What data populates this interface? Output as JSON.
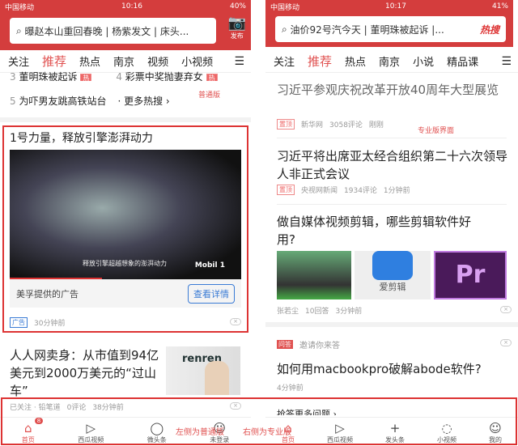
{
  "left": {
    "status": {
      "carrier": "中国移动",
      "time": "10:16",
      "battery": "40%"
    },
    "search": "曝赵本山重回春晚 | 杨紫发文 | 床头...",
    "publish": "发布",
    "tabs": [
      "关注",
      "推荐",
      "热点",
      "南京",
      "视频",
      "小视频"
    ],
    "hot": [
      {
        "n": "3",
        "t": "董明珠被起诉",
        "tag": "热"
      },
      {
        "n": "4",
        "t": "彩票中奖抛妻弃女",
        "tag": "热"
      },
      {
        "n": "5",
        "t": "为吓男友跳高铁站台"
      }
    ],
    "more": "· 更多热搜 ›",
    "note": "普通版",
    "ad": {
      "title": "1号力量，释放引擎澎湃动力",
      "caption": "释放引擎超越想象的澎湃动力",
      "logo": "Mobil 1",
      "sponsor": "美孚提供的广告",
      "button": "查看详情",
      "tag": "广告",
      "time": "30分钟前"
    },
    "article": {
      "title": "人人网卖身：从市值到94亿美元到2000万美元的“过山车”",
      "img_text": "renren",
      "source": "已关注 · 铅笔道",
      "comments": "0评论",
      "time": "38分钟前"
    },
    "nav": [
      {
        "label": "首页",
        "icon": "home-icon",
        "badge": "8"
      },
      {
        "label": "西瓜视频",
        "icon": "play-icon"
      },
      {
        "label": "微头条",
        "icon": "chat-icon"
      },
      {
        "label": "未登录",
        "icon": "user-icon"
      }
    ]
  },
  "right": {
    "status": {
      "carrier": "中国移动",
      "time": "10:17",
      "battery": "41%"
    },
    "search": "油价92号汽今天 | 董明珠被起诉 |...",
    "hot_label": "热搜",
    "tabs": [
      "关注",
      "推荐",
      "热点",
      "南京",
      "小说",
      "精品课"
    ],
    "note": "专业版界面",
    "articles": [
      {
        "title": "习近平参观庆祝改革开放40周年大型展览",
        "tag": "置顶",
        "source": "新华网",
        "comments": "3058评论",
        "time": "刚刚"
      },
      {
        "title": "习近平将出席亚太经合组织第二十六次领导人非正式会议",
        "tag": "置顶",
        "source": "央视网新闻",
        "comments": "1934评论",
        "time": "1分钟前"
      },
      {
        "title": "做自媒体视频剪辑，哪些剪辑软件好用?",
        "images": [
          "",
          "爱剪辑",
          "Pr"
        ],
        "source": "张若尘",
        "comments": "10回答",
        "time": "3分钟前"
      }
    ],
    "qa": {
      "tag": "问答",
      "invite": "邀请你来答",
      "title": "如何用macbookpro破解abode软件?",
      "time": "4分钟前",
      "more": "抢答更多问题 ›"
    },
    "nav": [
      {
        "label": "首页",
        "icon": "home-icon"
      },
      {
        "label": "西瓜视频",
        "icon": "play-icon"
      },
      {
        "label": "发头条",
        "icon": "plus-icon"
      },
      {
        "label": "小视频",
        "icon": "small-video-icon"
      },
      {
        "label": "我的",
        "icon": "user-icon"
      }
    ]
  },
  "annotation": {
    "left": "左侧为普通版",
    "right": "右侧为专业版"
  },
  "colors": {
    "brand": "#d43d3d",
    "accent": "#e0504f",
    "ad_button": "#3a7bd5"
  }
}
